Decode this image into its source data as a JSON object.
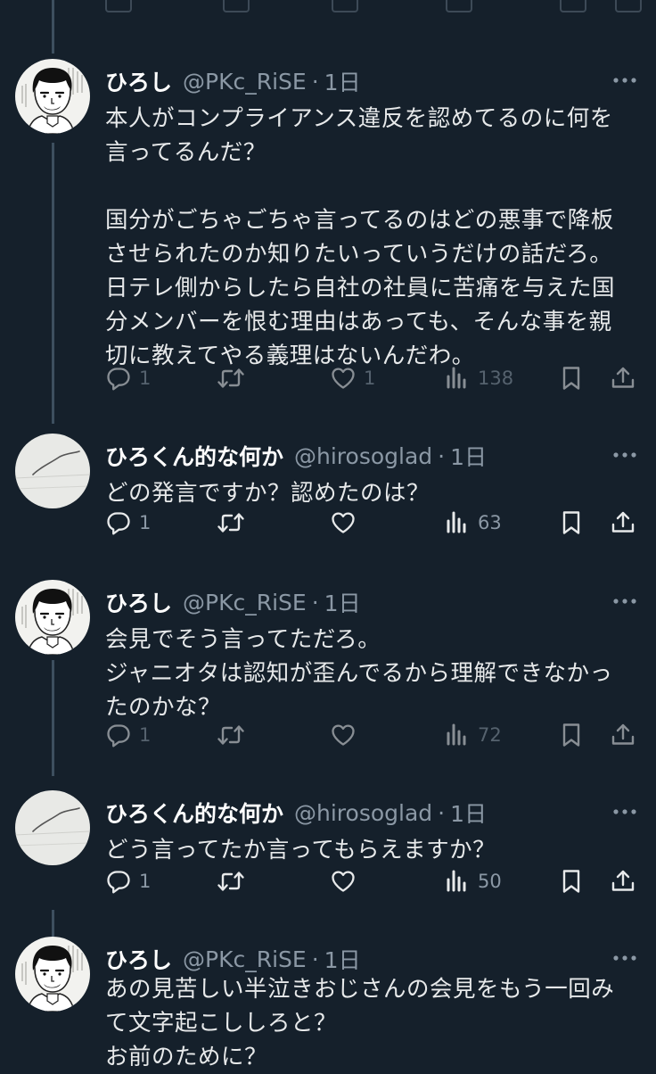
{
  "tweets": [
    {
      "name": "ひろし",
      "handle": "@PKc_RiSE",
      "sep": "·",
      "time": "1日",
      "text": "本人がコンプライアンス違反を認めてるのに何を\n言ってるんだ？\n\n国分がごちゃごちゃ言ってるのはどの悪事で降板\nさせられたのか知りたいっていうだけの話だろ。\n日テレ側からしたら自社の社員に苦痛を与えた国\n分メンバーを恨む理由はあっても、そんな事を親\n切に教えてやる義理はないんだわ。",
      "reply_count": "1",
      "retweet_count": "",
      "like_count": "1",
      "view_count": "138"
    },
    {
      "name": "ひろくん的な何か",
      "handle": "@hirosoglad",
      "sep": "·",
      "time": "1日",
      "text": "どの発言ですか？認めたのは？",
      "reply_count": "1",
      "retweet_count": "",
      "like_count": "",
      "view_count": "63"
    },
    {
      "name": "ひろし",
      "handle": "@PKc_RiSE",
      "sep": "·",
      "time": "1日",
      "text": "会見でそう言ってただろ。\nジャニオタは認知が歪んでるから理解できなかっ\nたのかな？",
      "reply_count": "1",
      "retweet_count": "",
      "like_count": "",
      "view_count": "72"
    },
    {
      "name": "ひろくん的な何か",
      "handle": "@hirosoglad",
      "sep": "·",
      "time": "1日",
      "text": "どう言ってたか言ってもらえますか？",
      "reply_count": "1",
      "retweet_count": "",
      "like_count": "",
      "view_count": "50"
    },
    {
      "name": "ひろし",
      "handle": "@PKc_RiSE",
      "sep": "·",
      "time": "1日",
      "text": "あの見苦しい半泣きおじさんの会見をもう一回み\nて文字起こししろと？\nお前のために？"
    }
  ],
  "colors": {
    "background": "#15202b",
    "text": "#e7e9ea",
    "secondary": "#8b98a5",
    "thread_line": "#3d4f5f"
  },
  "icons": {
    "reply": "reply-icon",
    "retweet": "retweet-icon",
    "like": "heart-icon",
    "views": "views-icon",
    "bookmark": "bookmark-icon",
    "share": "share-icon",
    "more": "more-icon"
  }
}
